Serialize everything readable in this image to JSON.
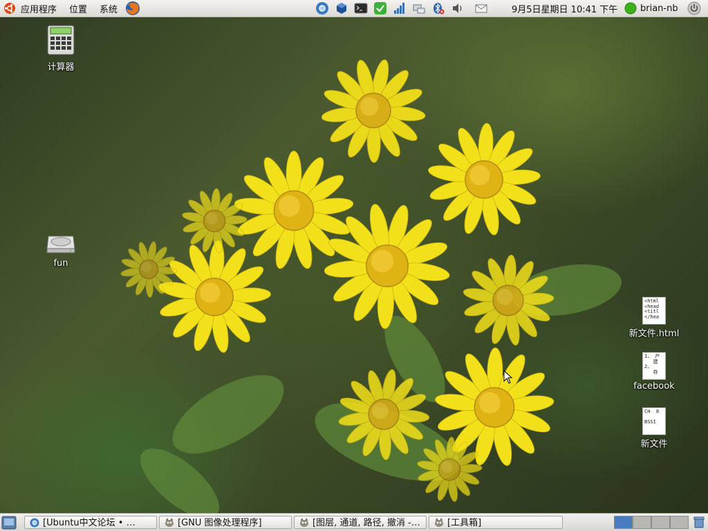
{
  "top_panel": {
    "menus": [
      "应用程序",
      "位置",
      "系统"
    ],
    "clock": "9月5日星期日 10:41 下午",
    "user": "brian-nb",
    "tray_icons": [
      "chromium-icon",
      "virtualbox-icon",
      "terminal-icon",
      "update-check-icon",
      "network-bars-icon",
      "network-manager-icon",
      "bluetooth-icon",
      "volume-icon",
      "mail-icon"
    ]
  },
  "desktop_icons": [
    {
      "name": "calculator-desktop-icon",
      "label": "计算器",
      "icon": "calculator-icon"
    },
    {
      "name": "fun-drive-desktop-icon",
      "label": "fun",
      "icon": "hard-drive-icon"
    },
    {
      "name": "new-file-html-desktop-icon",
      "label": "新文件.html",
      "icon": "text-document-icon",
      "preview": "<html\n<head\n<titl\n</hea"
    },
    {
      "name": "facebook-desktop-icon",
      "label": "facebook",
      "icon": "text-document-icon",
      "preview": "1、 产\n   建\n2、\n   存"
    },
    {
      "name": "new-file-desktop-icon",
      "label": "新文件",
      "icon": "text-document-icon",
      "preview": "CH  8\n\nBSSI"
    }
  ],
  "taskbar": {
    "tasks": [
      {
        "label": "[Ubuntu中文论坛 • …",
        "icon": "chromium-icon"
      },
      {
        "label": "[GNU 图像处理程序]",
        "icon": "gimp-icon"
      },
      {
        "label": "[图层, 通道, 路径, 撤消 -…",
        "icon": "gimp-icon"
      },
      {
        "label": "[工具箱]",
        "icon": "gimp-icon"
      }
    ],
    "workspaces": 4,
    "active_workspace": 1
  },
  "colors": {
    "panel_bg": "#dcdad5",
    "user_status": "#3cb31c",
    "workspace_active": "#4a7bbf",
    "petal": "#f2e01a",
    "flower_center": "#e0b315"
  }
}
